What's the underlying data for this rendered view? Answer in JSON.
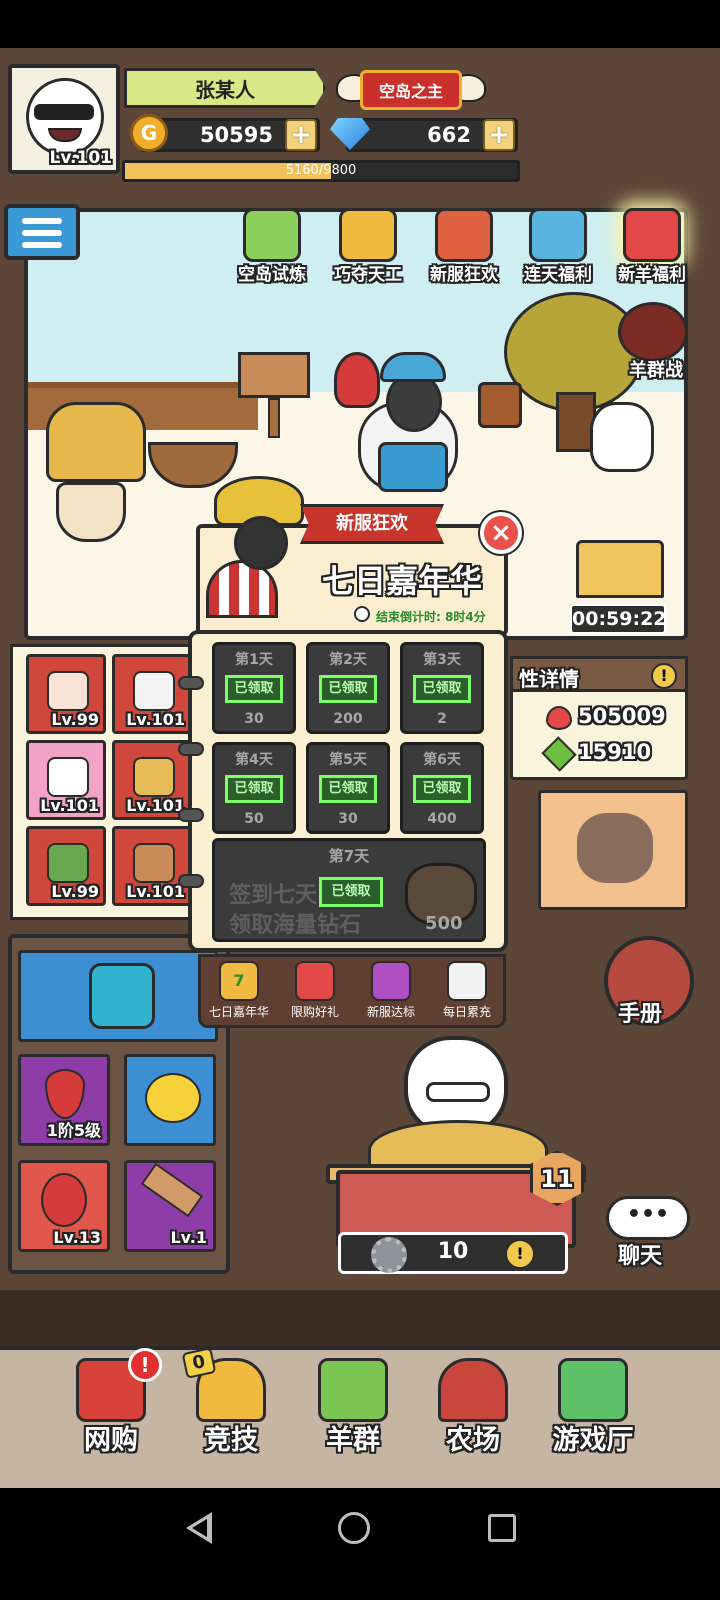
{
  "player": {
    "name": "张某人",
    "level": "Lv.101",
    "title": "空岛之主"
  },
  "currency": {
    "gold_symbol": "G",
    "gold": "50595",
    "gems": "662",
    "plus": "+"
  },
  "xp": {
    "text": "5160/9800",
    "fraction": 0.5265
  },
  "features": [
    {
      "label": "空岛试炼",
      "icon": "island-trial-icon"
    },
    {
      "label": "巧夺天工",
      "icon": "crafting-icon"
    },
    {
      "label": "新服狂欢",
      "icon": "new-server-carnival-icon"
    },
    {
      "label": "连天福利",
      "icon": "daily-welfare-icon"
    },
    {
      "label": "新羊福利",
      "icon": "new-sheep-welfare-icon"
    }
  ],
  "sheep_battle": {
    "label": "羊群战"
  },
  "chest_timer": "00:59:22",
  "equipment": [
    {
      "level": "Lv.99",
      "color": "#d0483c"
    },
    {
      "level": "Lv.101",
      "color": "#d0483c"
    },
    {
      "level": "Lv.101",
      "color": "#f3a2c7"
    },
    {
      "level": "Lv.101",
      "color": "#d0483c"
    },
    {
      "level": "Lv.99",
      "color": "#d0483c"
    },
    {
      "level": "Lv.101",
      "color": "#d0483c"
    }
  ],
  "stats": {
    "title": "性详情",
    "hp": "505009",
    "atk": "15910"
  },
  "bag_items": [
    {
      "label": "1阶5级",
      "color": "#8e3ca8",
      "icon": "droplet-icon"
    },
    {
      "label": "",
      "color": "#3c8fd3",
      "icon": "rubber-duck-icon"
    },
    {
      "label": "Lv.13",
      "color": "#e2574b",
      "icon": "parrot-icon"
    },
    {
      "label": "Lv.1",
      "color": "#8e3ca8",
      "icon": "comb-icon"
    }
  ],
  "pen": {
    "level": "11",
    "count": "10"
  },
  "handbook": {
    "label": "手册"
  },
  "chat": {
    "label": "聊天",
    "dots": "•••"
  },
  "popup": {
    "ribbon": "新服狂欢",
    "close": "×",
    "title": "七日嘉年华",
    "countdown": "结束倒计时: 8时4分",
    "days": [
      {
        "day": "第1天",
        "status": "已领取",
        "amount": "30"
      },
      {
        "day": "第2天",
        "status": "已领取",
        "amount": "200"
      },
      {
        "day": "第3天",
        "status": "已领取",
        "amount": "2"
      },
      {
        "day": "第4天",
        "status": "已领取",
        "amount": "50"
      },
      {
        "day": "第5天",
        "status": "已领取",
        "amount": "30"
      },
      {
        "day": "第6天",
        "status": "已领取",
        "amount": "400"
      }
    ],
    "day7": {
      "day": "第7天",
      "status": "已领取",
      "promo_line1": "签到七天",
      "promo_line2": "领取海量钻石",
      "amount": "500"
    },
    "tabs": [
      {
        "label": "七日嘉年华",
        "badge": "7"
      },
      {
        "label": "限购好礼"
      },
      {
        "label": "新服达标"
      },
      {
        "label": "每日累充"
      }
    ]
  },
  "bottom_nav": [
    {
      "label": "网购",
      "badge": "!"
    },
    {
      "label": "竞技",
      "badge": "0"
    },
    {
      "label": "羊群"
    },
    {
      "label": "农场"
    },
    {
      "label": "游戏厅"
    }
  ]
}
